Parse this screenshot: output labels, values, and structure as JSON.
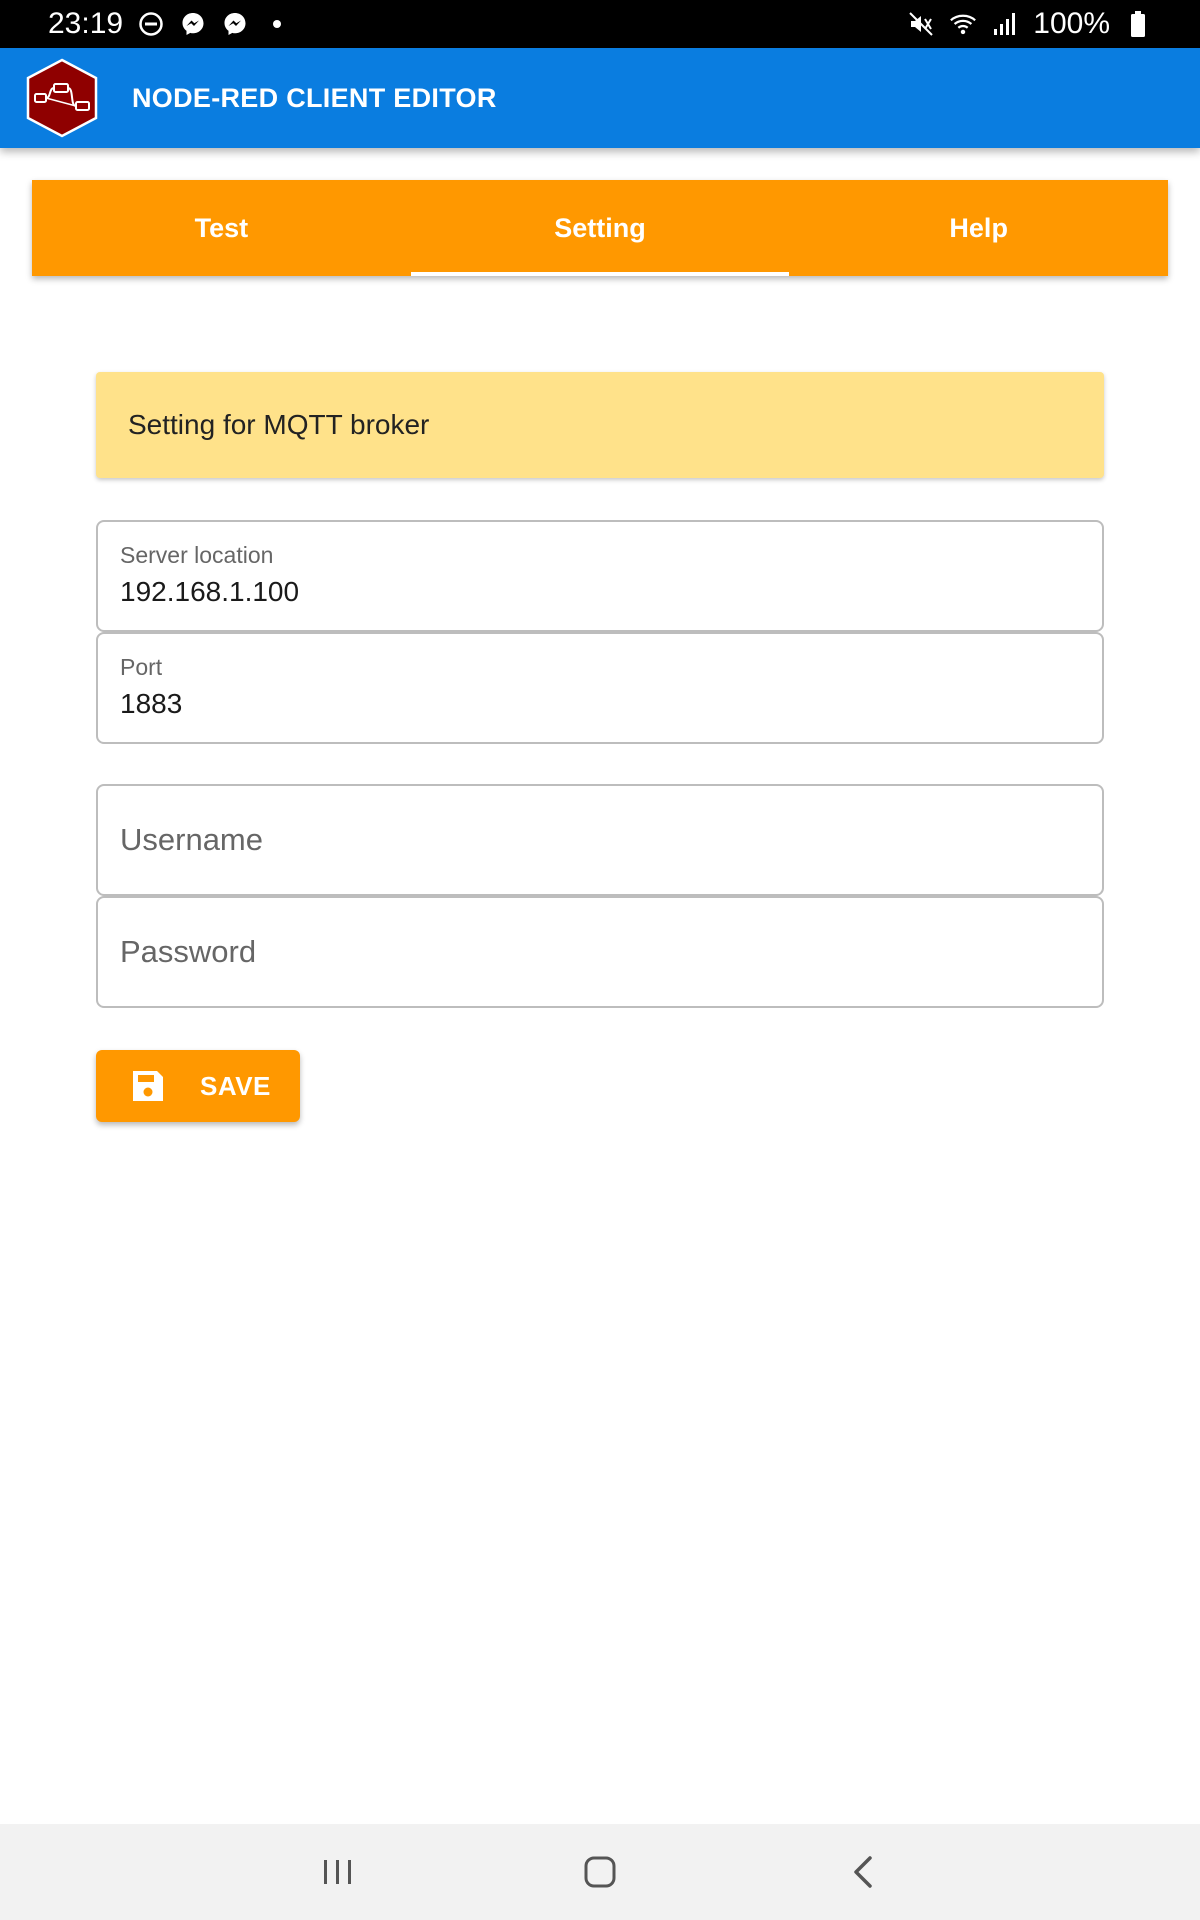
{
  "status_bar": {
    "time": "23:19",
    "battery": "100%",
    "icons": [
      "do-not-disturb-icon",
      "messenger-icon",
      "messenger-icon",
      "dot-icon",
      "mute-icon",
      "wifi-icon",
      "signal-icon",
      "battery-icon"
    ]
  },
  "app_bar": {
    "title": "NODE-RED CLIENT EDITOR",
    "logo_icon": "node-red-logo-icon"
  },
  "tabs": [
    {
      "label": "Test",
      "active": false
    },
    {
      "label": "Setting",
      "active": true
    },
    {
      "label": "Help",
      "active": false
    }
  ],
  "banner": {
    "text": "Setting for MQTT broker"
  },
  "form": {
    "server": {
      "label": "Server location",
      "value": "192.168.1.100"
    },
    "port": {
      "label": "Port",
      "value": "1883"
    },
    "username": {
      "placeholder": "Username",
      "value": ""
    },
    "password": {
      "placeholder": "Password",
      "value": ""
    }
  },
  "save_button": {
    "label": "SAVE",
    "icon": "floppy-disk-icon"
  },
  "nav_bar": {
    "icons": [
      "recent-apps-icon",
      "home-icon",
      "back-icon"
    ]
  },
  "colors": {
    "app_bar": "#0a7de0",
    "accent": "#ff9800",
    "banner": "#ffe28a"
  }
}
